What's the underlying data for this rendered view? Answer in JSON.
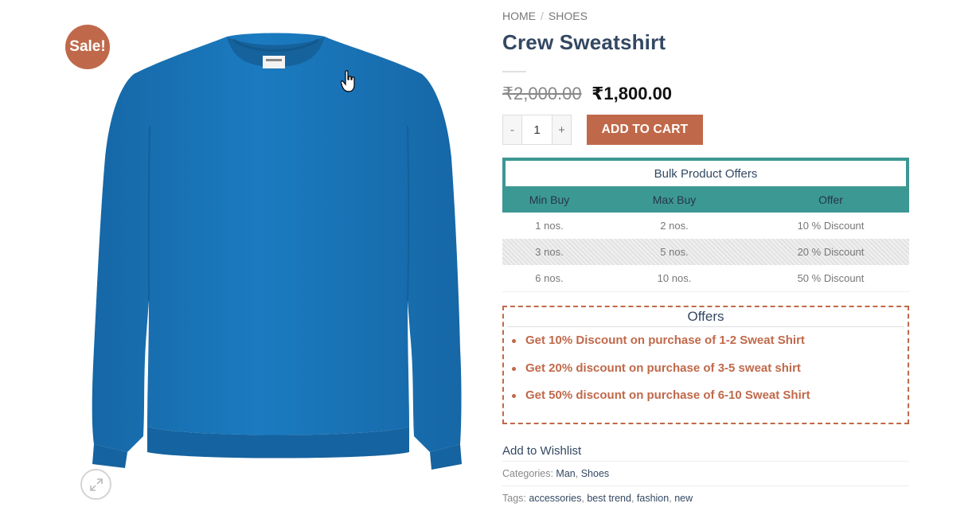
{
  "badge": {
    "label": "Sale!"
  },
  "breadcrumb": {
    "home": "HOME",
    "separator": "/",
    "category": "SHOES"
  },
  "product": {
    "title": "Crew Sweatshirt",
    "old_price": "₹2,000.00",
    "new_price": "₹1,800.00",
    "color": "#1a74b5"
  },
  "cart": {
    "minus": "-",
    "quantity": "1",
    "plus": "+",
    "add_label": "ADD TO CART"
  },
  "bulk": {
    "title": "Bulk Product Offers",
    "headers": [
      "Min Buy",
      "Max Buy",
      "Offer"
    ],
    "rows": [
      [
        "1 nos.",
        "2 nos.",
        "10 % Discount"
      ],
      [
        "3 nos.",
        "5 nos.",
        "20 % Discount"
      ],
      [
        "6 nos.",
        "10 nos.",
        "50 % Discount"
      ]
    ]
  },
  "offers": {
    "title": "Offers",
    "items": [
      "Get 10% Discount on purchase of 1-2 Sweat Shirt",
      "Get 20% discount on purchase of 3-5 sweat shirt",
      "Get 50% discount on purchase of 6-10 Sweat Shirt"
    ]
  },
  "wishlist": {
    "label": "Add to Wishlist"
  },
  "meta": {
    "categories_label": "Categories:",
    "categories": [
      "Man",
      "Shoes"
    ],
    "tags_label": "Tags:",
    "tags": [
      "accessories",
      "best trend",
      "fashion",
      "new"
    ],
    "separator": ","
  },
  "colors": {
    "accent": "#c0694a",
    "teal": "#3c9893",
    "text": "#334862"
  }
}
